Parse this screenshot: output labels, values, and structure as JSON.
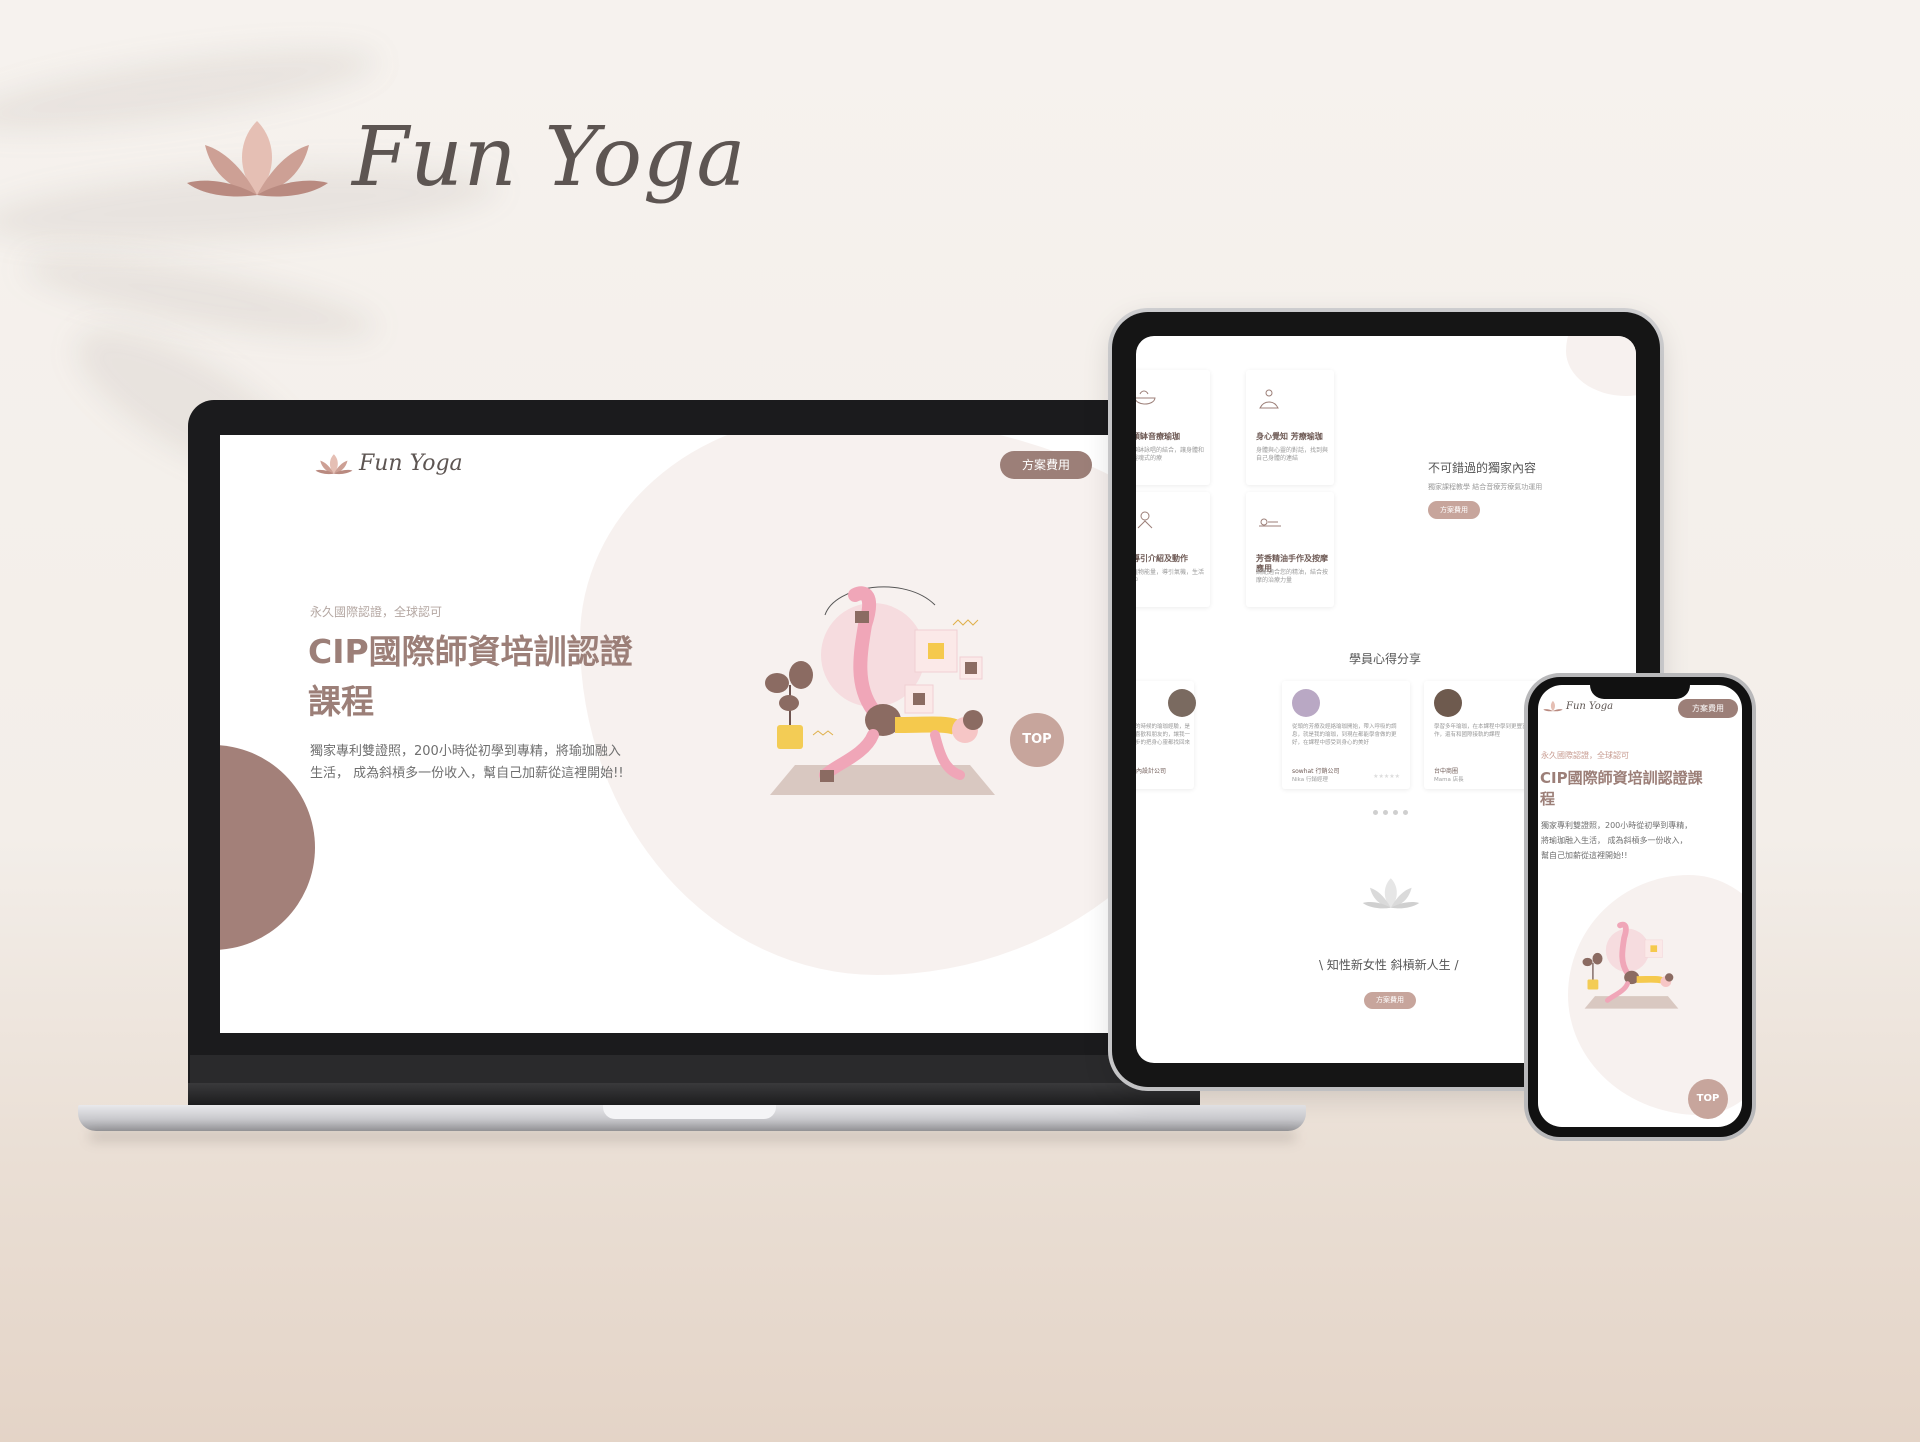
{
  "brand": {
    "name": "Fun Yoga"
  },
  "colors": {
    "accent": "#9c7f78",
    "title": "#9c7f78",
    "text": "#6f6f6f",
    "blob": "#f7f1ef"
  },
  "laptop": {
    "logo": "Fun Yoga",
    "nav_button": "方案費用",
    "subtitle": "永久國際認證，全球認可",
    "title_line1": "CIP國際師資培訓認證",
    "title_line2": "課程",
    "desc_line1": "獨家專利雙證照，200小時從初學到專精，將瑜珈融入",
    "desc_line2": "生活， 成為斜槓多一份收入，幫自己加薪從這裡開始!!",
    "top_button": "TOP"
  },
  "tablet": {
    "features": [
      {
        "title": "頌缽音療瑜珈",
        "desc": "頌缽詠唱的結合，讓身體和靈魂式的療"
      },
      {
        "title": "身心覺知 芳療瑜珈",
        "desc": "身體與心靈的對話，找到與自己身體的連結"
      },
      {
        "title": "導引介紹及動作",
        "desc": "植物能量，導引氣機，生活中"
      },
      {
        "title": "芳香精油手作及按摩應用",
        "desc": "調配適合您的精油，結合按摩的治療力量"
      }
    ],
    "exclusive_title": "不可錯過的獨家內容",
    "exclusive_desc": "獨家課程教學 結合音療芳療氣功運用",
    "exclusive_button": "方案費用",
    "reviews_title": "學員心得分享",
    "reviews": [
      {
        "text": "過去的時候的瑜珈經驗，是我最喜歡和朋友的，讓我一步一步的把身心靈都找回來",
        "name": "海大內設計公司",
        "role": "行銷"
      },
      {
        "text": "從頭的芳療及經絡瑜珈開始，帶入呼吸的調息，就是我的瑜珈，到現在都能學會做的更好，在課程中感受到身心的美好",
        "name": "sowhat 行銷公司",
        "role": "Nika 行銷經理"
      },
      {
        "text": "學習多年瑜珈，在本課程中學到更豐富的動作，還有和國際接軌的課程",
        "name": "台中商圈",
        "role": "Mama 店長"
      }
    ],
    "slogan": "\\ 知性新女性 斜槓新人生 /",
    "bottom_button": "方案費用"
  },
  "phone": {
    "logo": "Fun Yoga",
    "nav_button": "方案費用",
    "subtitle": "永久國際認證，全球認可",
    "title_line1": "CIP國際師資培訓認證課",
    "title_line2": "程",
    "desc_line1": "獨家專利雙證照，200小時從初學到專精，",
    "desc_line2": "將瑜珈融入生活， 成為斜槓多一份收入，",
    "desc_line3": "幫自己加薪從這裡開始!!",
    "top_button": "TOP"
  }
}
